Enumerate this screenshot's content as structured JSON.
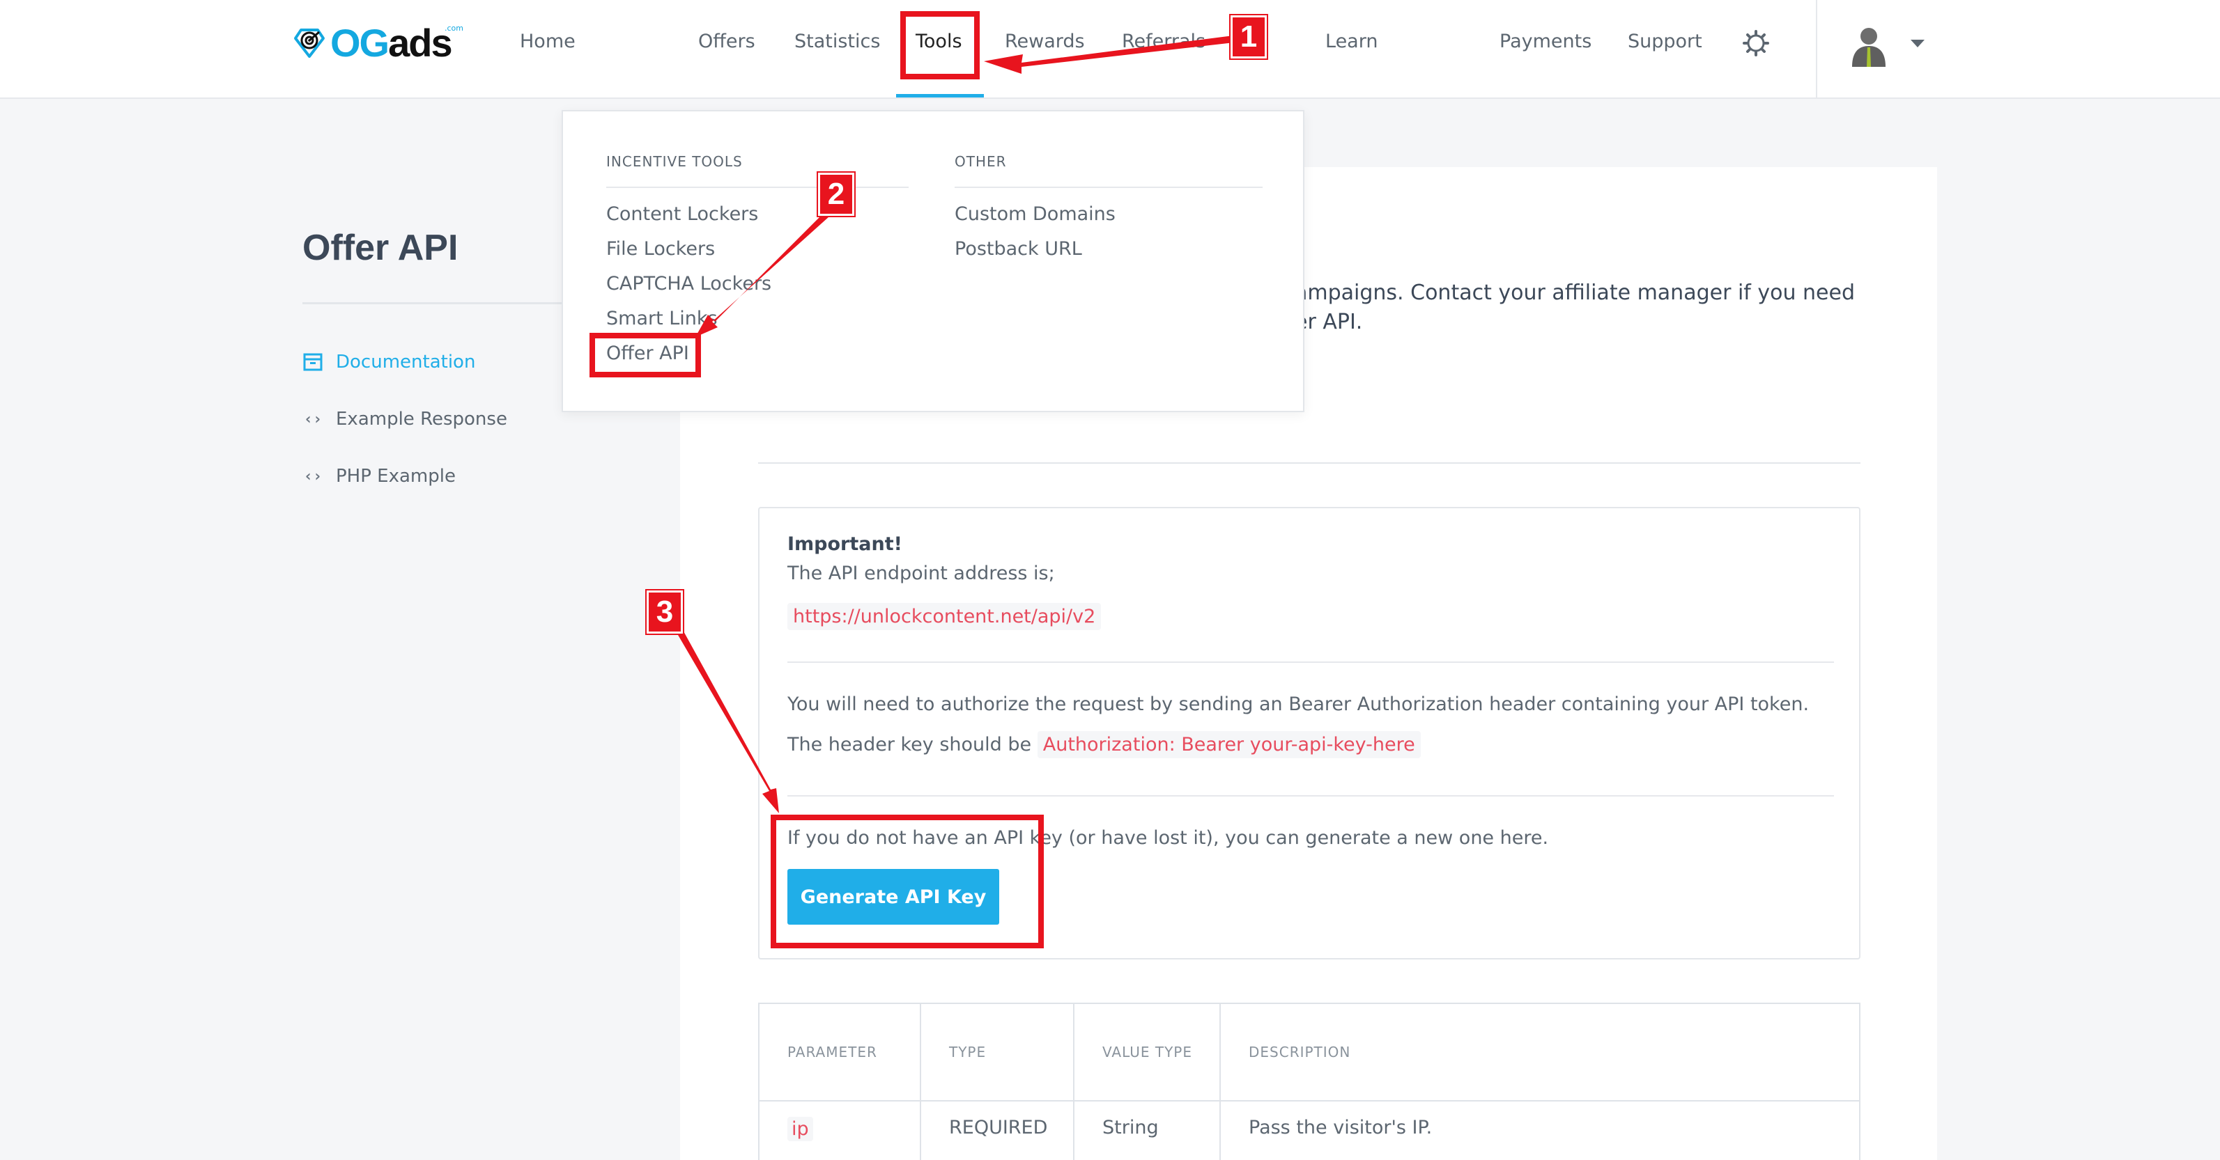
{
  "brand": {
    "logo_text_accent": "OG",
    "logo_text_main": "ads",
    "logo_suffix": ".com",
    "accent_color": "#20aee8",
    "annotation_color": "#e8141e"
  },
  "nav": {
    "home": "Home",
    "offers": "Offers",
    "statistics": "Statistics",
    "tools": "Tools",
    "rewards": "Rewards",
    "referrals": "Referrals",
    "learn": "Learn",
    "payments": "Payments",
    "support": "Support",
    "settings_icon": "gear-icon",
    "avatar_icon": "user-avatar-icon"
  },
  "sidebar": {
    "title": "Offer API",
    "items": [
      {
        "label": "Documentation",
        "icon": "archive-icon",
        "active": true
      },
      {
        "label": "Example Response",
        "icon": "code-icon",
        "active": false
      },
      {
        "label": "PHP Example",
        "icon": "php-code-icon",
        "active": false
      }
    ]
  },
  "dropdown": {
    "incentive_heading": "INCENTIVE TOOLS",
    "incentive_items": [
      "Content Lockers",
      "File Lockers",
      "CAPTCHA Lockers",
      "Smart Links",
      "Offer API"
    ],
    "other_heading": "OTHER",
    "other_items": [
      "Custom Domains",
      "Postback URL"
    ]
  },
  "main": {
    "intro_line1": "ampaigns. Contact your affiliate manager if you need",
    "intro_line2": "er API.",
    "important_title": "Important!",
    "endpoint_label": "The API endpoint address is;",
    "endpoint_url": "https://unlockcontent.net/api/v2",
    "auth_text": "You will need to authorize the request by sending an Bearer Authorization header containing your API token.",
    "header_key_label": "The header key should be",
    "header_key_value": "Authorization: Bearer your-api-key-here",
    "generate_text": "If you do not have an API key (or have lost it), you can generate a new one here.",
    "generate_button": "Generate API Key"
  },
  "table": {
    "headers": [
      "PARAMETER",
      "TYPE",
      "VALUE TYPE",
      "DESCRIPTION"
    ],
    "rows": [
      {
        "parameter": "ip",
        "type": "REQUIRED",
        "value_type": "String",
        "description": "Pass the visitor's IP."
      }
    ]
  },
  "annotations": {
    "step1": "1",
    "step2": "2",
    "step3": "3"
  }
}
